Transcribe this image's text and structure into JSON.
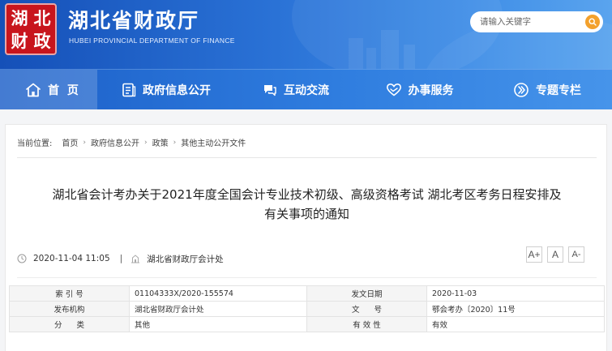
{
  "header": {
    "seal_chars": [
      "湖",
      "北",
      "财",
      "政"
    ],
    "title": "湖北省财政厅",
    "subtitle": "HUBEI PROVINCIAL DEPARTMENT OF FINANCE",
    "search_placeholder": "请输入关键字",
    "search_icon": "search-icon"
  },
  "nav": [
    {
      "label": "首  页",
      "icon": "home-icon"
    },
    {
      "label": "政府信息公开",
      "icon": "document-icon"
    },
    {
      "label": "互动交流",
      "icon": "chat-icon"
    },
    {
      "label": "办事服务",
      "icon": "heart-hands-icon"
    },
    {
      "label": "专题专栏",
      "icon": "chevron-circle-icon"
    }
  ],
  "breadcrumb": {
    "label": "当前位置:",
    "items": [
      "首页",
      "政府信息公开",
      "政策",
      "其他主动公开文件"
    ]
  },
  "article": {
    "title_line1": "湖北省会计考办关于2021年度全国会计专业技术初级、高级资格考试 湖北考区考务日程安排及",
    "title_line2": "有关事项的通知",
    "datetime": "2020-11-04 11:05",
    "divider": "|",
    "source": "湖北省财政厅会计处",
    "font_sizes": [
      "A+",
      "A",
      "A-"
    ]
  },
  "info": {
    "rows": [
      [
        {
          "k": "索 引 号",
          "v": "01104333X/2020-155574"
        },
        {
          "k": "发文日期",
          "v": "2020-11-03"
        }
      ],
      [
        {
          "k": "发布机构",
          "v": "湖北省财政厅会计处"
        },
        {
          "k": "文      号",
          "v": "鄂会考办〔2020〕11号"
        }
      ],
      [
        {
          "k": "分      类",
          "v": "其他"
        },
        {
          "k": "有 效 性",
          "v": "有效"
        }
      ]
    ]
  },
  "colors": {
    "header_blue": "#1550b8",
    "nav_blue": "#2f7ddf",
    "seal_red": "#c8151d",
    "search_orange": "#f3a12c"
  }
}
